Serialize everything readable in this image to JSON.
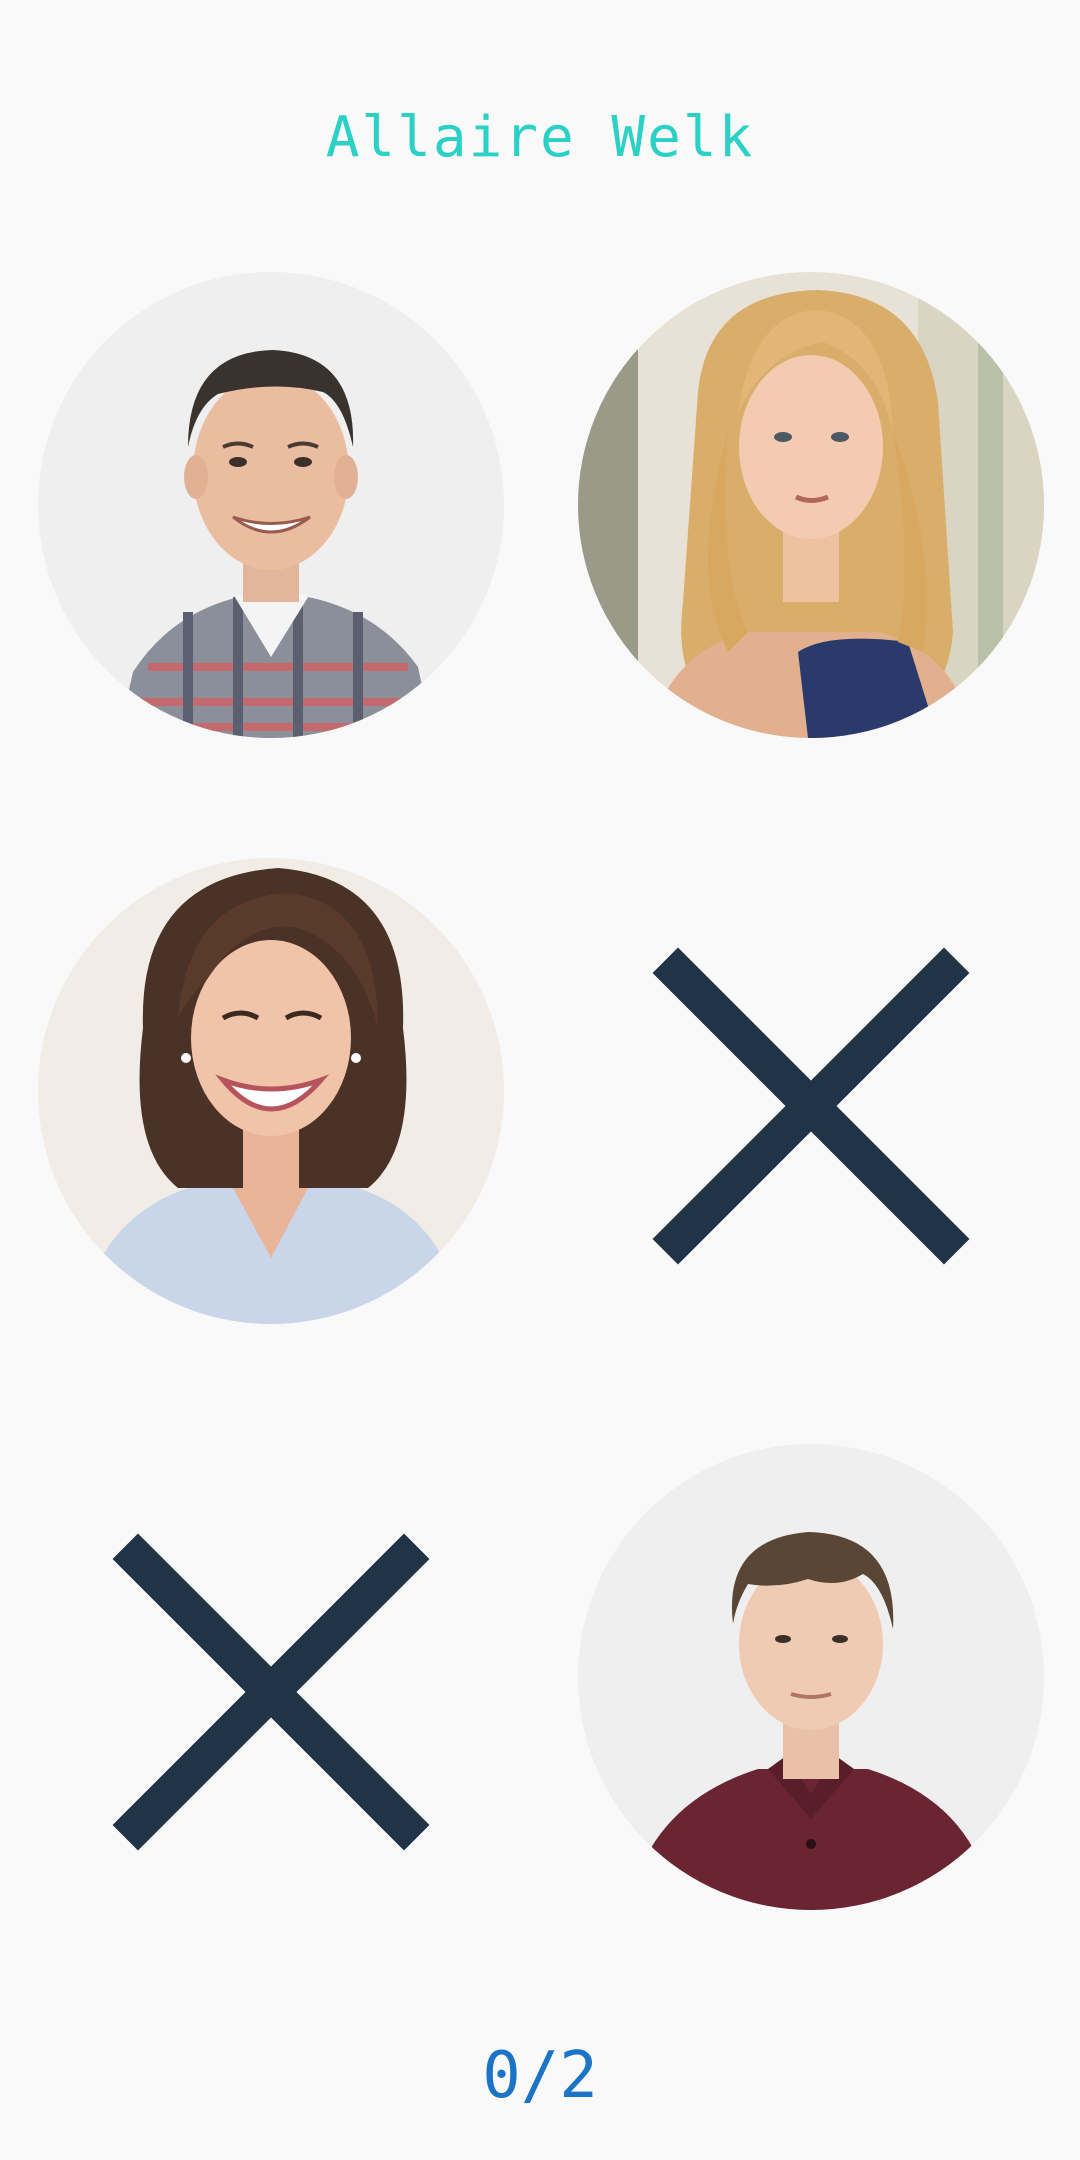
{
  "title": "Allaire Welk",
  "score": "0/2",
  "colors": {
    "title": "#2bd1c4",
    "score": "#1b74c5",
    "cross": "#213347",
    "background": "#f9f9f9"
  },
  "tiles": [
    {
      "kind": "photo",
      "icon": "man-portrait-plaid-shirt"
    },
    {
      "kind": "photo",
      "icon": "woman-portrait-blonde"
    },
    {
      "kind": "photo",
      "icon": "woman-portrait-brunette"
    },
    {
      "kind": "cross",
      "icon": "x-icon"
    },
    {
      "kind": "cross",
      "icon": "x-icon"
    },
    {
      "kind": "photo",
      "icon": "man-portrait-maroon-polo"
    }
  ]
}
